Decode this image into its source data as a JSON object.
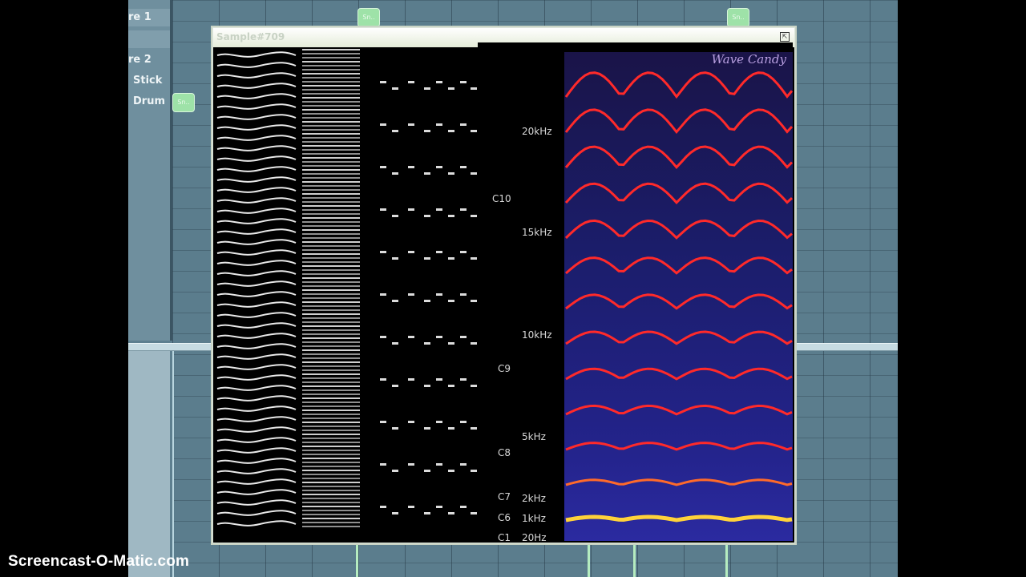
{
  "tracks": [
    {
      "label": "re 1"
    },
    {
      "label": ""
    },
    {
      "label": "re 2"
    },
    {
      "label": "Stick"
    },
    {
      "label": "Drum"
    }
  ],
  "green_block_label": "Sn..",
  "plugin": {
    "title": "Sample#709",
    "brand": "Wave Candy"
  },
  "spectrogram": {
    "note_labels": [
      "C10",
      "C9",
      "C8",
      "C7",
      "C6",
      "C1"
    ],
    "freq_labels": [
      "20kHz",
      "15kHz",
      "10kHz",
      "5kHz",
      "2kHz",
      "1kHz",
      "20Hz"
    ]
  },
  "watermark": "Screencast-O-Matic.com",
  "colors": {
    "playlist_bg": "#5b7d8d",
    "spectrum_hot": "#ff2a2a",
    "spectrum_low": "#ffd23a",
    "green_block": "#9ee2a8"
  }
}
